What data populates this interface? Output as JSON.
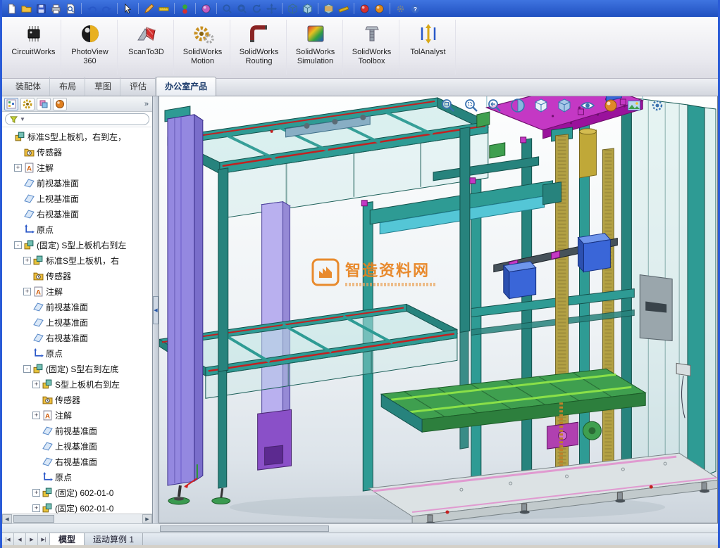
{
  "colors": {
    "accent_blue": "#2050c0",
    "teal": "#2e9b94",
    "magenta": "#c438c4",
    "purple": "#9488e0",
    "green": "#3f9f4f",
    "gold": "#b3a144",
    "watermark_orange": "#e8821e"
  },
  "top_toolbar": {
    "icons": [
      "new",
      "open",
      "save",
      "print",
      "print-preview",
      "sep",
      "undo",
      "redo",
      "sep",
      "select",
      "sep",
      "sketch",
      "dimension",
      "sep",
      "rebuild",
      "sep",
      "edit-color",
      "sep",
      "zoom-to-fit",
      "zoom-to-area",
      "rotate-view",
      "pan",
      "sep",
      "wireframe",
      "shaded",
      "sep",
      "section-view",
      "measure",
      "sep",
      "motion-red",
      "appearance-orange",
      "sep",
      "options",
      "help"
    ]
  },
  "ribbon": {
    "items": [
      {
        "id": "circuitworks",
        "label": "CircuitWorks"
      },
      {
        "id": "photoview360",
        "label": "PhotoView\n360"
      },
      {
        "id": "scanto3d",
        "label": "ScanTo3D"
      },
      {
        "id": "sw-motion",
        "label": "SolidWorks\nMotion"
      },
      {
        "id": "sw-routing",
        "label": "SolidWorks\nRouting"
      },
      {
        "id": "sw-simulation",
        "label": "SolidWorks\nSimulation"
      },
      {
        "id": "sw-toolbox",
        "label": "SolidWorks\nToolbox"
      },
      {
        "id": "tolanalyst",
        "label": "TolAnalyst"
      }
    ]
  },
  "command_tabs": {
    "tabs": [
      {
        "label": "装配体",
        "active": false
      },
      {
        "label": "布局",
        "active": false
      },
      {
        "label": "草图",
        "active": false
      },
      {
        "label": "评估",
        "active": false
      },
      {
        "label": "办公室产品",
        "active": true
      }
    ]
  },
  "feature_panel": {
    "tabs": [
      "feature-manager",
      "property-manager",
      "configuration-manager",
      "appearances"
    ],
    "overflow_chevron": "»",
    "filter": {
      "placeholder": ""
    },
    "tree": [
      {
        "label": "标准S型上板机，右到左，",
        "level": 0,
        "icon": "assembly",
        "expander": ""
      },
      {
        "label": "传感器",
        "level": 1,
        "icon": "sensors",
        "expander": ""
      },
      {
        "label": "注解",
        "level": 1,
        "icon": "annotations",
        "expander": "+"
      },
      {
        "label": "前视基准面",
        "level": 1,
        "icon": "plane",
        "expander": ""
      },
      {
        "label": "上视基准面",
        "level": 1,
        "icon": "plane",
        "expander": ""
      },
      {
        "label": "右视基准面",
        "level": 1,
        "icon": "plane",
        "expander": ""
      },
      {
        "label": "原点",
        "level": 1,
        "icon": "origin",
        "expander": ""
      },
      {
        "label": "(固定) S型上板机右到左",
        "level": 1,
        "icon": "assembly",
        "expander": "-"
      },
      {
        "label": "标准S型上板机，右",
        "level": 2,
        "icon": "assembly",
        "expander": "+"
      },
      {
        "label": "传感器",
        "level": 2,
        "icon": "sensors",
        "expander": ""
      },
      {
        "label": "注解",
        "level": 2,
        "icon": "annotations",
        "expander": "+"
      },
      {
        "label": "前视基准面",
        "level": 2,
        "icon": "plane",
        "expander": ""
      },
      {
        "label": "上视基准面",
        "level": 2,
        "icon": "plane",
        "expander": ""
      },
      {
        "label": "右视基准面",
        "level": 2,
        "icon": "plane",
        "expander": ""
      },
      {
        "label": "原点",
        "level": 2,
        "icon": "origin",
        "expander": ""
      },
      {
        "label": "(固定) S型右到左底",
        "level": 2,
        "icon": "assembly",
        "expander": "-"
      },
      {
        "label": "S型上板机右到左",
        "level": 3,
        "icon": "assembly",
        "expander": "+"
      },
      {
        "label": "传感器",
        "level": 3,
        "icon": "sensors",
        "expander": ""
      },
      {
        "label": "注解",
        "level": 3,
        "icon": "annotations",
        "expander": "+"
      },
      {
        "label": "前视基准面",
        "level": 3,
        "icon": "plane",
        "expander": ""
      },
      {
        "label": "上视基准面",
        "level": 3,
        "icon": "plane",
        "expander": ""
      },
      {
        "label": "右视基准面",
        "level": 3,
        "icon": "plane",
        "expander": ""
      },
      {
        "label": "原点",
        "level": 3,
        "icon": "origin",
        "expander": ""
      },
      {
        "label": "(固定) 602-01-0",
        "level": 3,
        "icon": "assembly",
        "expander": "+"
      },
      {
        "label": "(固定) 602-01-0",
        "level": 3,
        "icon": "assembly",
        "expander": "+"
      }
    ]
  },
  "viewport": {
    "hud_icons": [
      "zoom-to-fit",
      "zoom-to-area",
      "previous-view",
      "section-view",
      "view-orientation",
      "display-style",
      "hide-show-items",
      "edit-appearance",
      "apply-scene",
      "view-settings"
    ],
    "watermark": {
      "title": "智造资料网"
    }
  },
  "bottom_bar": {
    "nav_icons": [
      "first",
      "prev",
      "next",
      "last"
    ],
    "tabs": [
      {
        "label": "模型",
        "active": true
      },
      {
        "label": "运动算例 1",
        "active": false
      }
    ]
  }
}
